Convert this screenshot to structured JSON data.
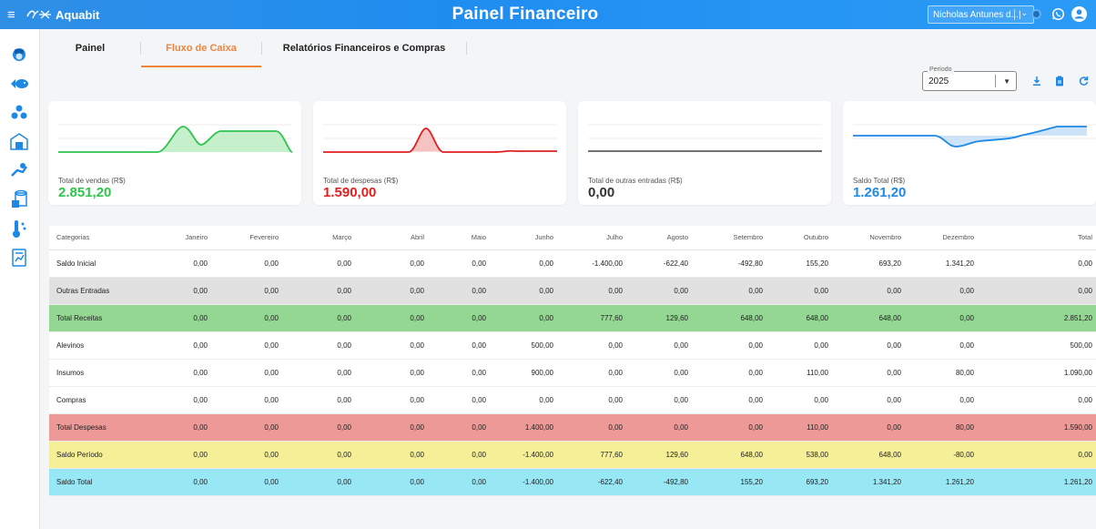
{
  "header": {
    "brand": "Aquabit",
    "title": "Painel Financeiro",
    "user": "Nicholas Antunes d...|"
  },
  "tabs": [
    {
      "label": "Painel"
    },
    {
      "label": "Fluxo de Caixa"
    },
    {
      "label": "Relatórios Financeiros e Compras"
    }
  ],
  "period": {
    "label": "Período",
    "value": "2025"
  },
  "cards": [
    {
      "label": "Total de vendas (R$)",
      "value": "2.851,20",
      "color": "#2ec44d"
    },
    {
      "label": "Total de despesas (R$)",
      "value": "1.590,00",
      "color": "#e01f1f"
    },
    {
      "label": "Total de outras entradas (R$)",
      "value": "0,00",
      "color": "#333333"
    },
    {
      "label": "Saldo Total (R$)",
      "value": "1.261,20",
      "color": "#1e88e5"
    }
  ],
  "table": {
    "headers": [
      "Categorias",
      "Janeiro",
      "Fevereiro",
      "Março",
      "Abril",
      "Maio",
      "Junho",
      "Julho",
      "Agosto",
      "Setembro",
      "Outubro",
      "Novembro",
      "Dezembro",
      "Total"
    ],
    "rows": [
      {
        "style": "plain",
        "cells": [
          "Saldo Inicial",
          "0,00",
          "0,00",
          "0,00",
          "0,00",
          "0,00",
          "0,00",
          "-1.400,00",
          "-622,40",
          "-492,80",
          "155,20",
          "693,20",
          "1.341,20",
          "0,00"
        ]
      },
      {
        "style": "gray",
        "cells": [
          "Outras Entradas",
          "0,00",
          "0,00",
          "0,00",
          "0,00",
          "0,00",
          "0,00",
          "0,00",
          "0,00",
          "0,00",
          "0,00",
          "0,00",
          "0,00",
          "0,00"
        ]
      },
      {
        "style": "green",
        "cells": [
          "Total Receitas",
          "0,00",
          "0,00",
          "0,00",
          "0,00",
          "0,00",
          "0,00",
          "777,60",
          "129,60",
          "648,00",
          "648,00",
          "648,00",
          "0,00",
          "2.851,20"
        ]
      },
      {
        "style": "plain",
        "cells": [
          "Alevinos",
          "0,00",
          "0,00",
          "0,00",
          "0,00",
          "0,00",
          "500,00",
          "0,00",
          "0,00",
          "0,00",
          "0,00",
          "0,00",
          "0,00",
          "500,00"
        ]
      },
      {
        "style": "plain",
        "cells": [
          "Insumos",
          "0,00",
          "0,00",
          "0,00",
          "0,00",
          "0,00",
          "900,00",
          "0,00",
          "0,00",
          "0,00",
          "110,00",
          "0,00",
          "80,00",
          "1.090,00"
        ]
      },
      {
        "style": "plain",
        "cells": [
          "Compras",
          "0,00",
          "0,00",
          "0,00",
          "0,00",
          "0,00",
          "0,00",
          "0,00",
          "0,00",
          "0,00",
          "0,00",
          "0,00",
          "0,00",
          "0,00"
        ]
      },
      {
        "style": "red",
        "cells": [
          "Total Despesas",
          "0,00",
          "0,00",
          "0,00",
          "0,00",
          "0,00",
          "1.400,00",
          "0,00",
          "0,00",
          "0,00",
          "110,00",
          "0,00",
          "80,00",
          "1.590,00"
        ]
      },
      {
        "style": "yellow",
        "cells": [
          "Saldo Período",
          "0,00",
          "0,00",
          "0,00",
          "0,00",
          "0,00",
          "-1.400,00",
          "777,60",
          "129,60",
          "648,00",
          "538,00",
          "648,00",
          "-80,00",
          "0,00"
        ]
      },
      {
        "style": "cyan",
        "cells": [
          "Saldo Total",
          "0,00",
          "0,00",
          "0,00",
          "0,00",
          "0,00",
          "-1.400,00",
          "-622,40",
          "-492,80",
          "155,20",
          "693,20",
          "1.341,20",
          "1.261,20",
          "1.261,20"
        ]
      }
    ]
  },
  "icons": {
    "menu": "menu-icon",
    "wave": "wave-logo-icon",
    "whatsapp": "whatsapp-icon",
    "account": "account-circle-icon",
    "download": "download-icon",
    "clipboard": "clipboard-icon",
    "refresh": "refresh-icon"
  }
}
